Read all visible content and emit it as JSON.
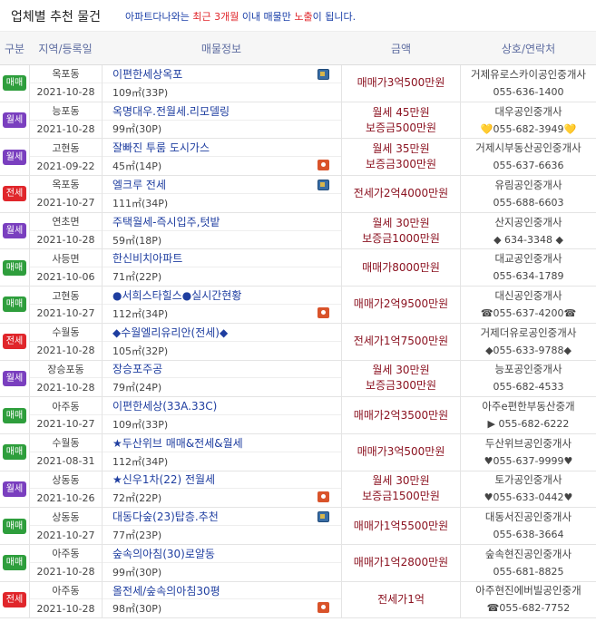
{
  "header": {
    "title": "업체별 추천 물건",
    "notice_prefix": "아파트다나와는 ",
    "notice_red1": "최근 3개월",
    "notice_mid": " 이내 매물만 ",
    "notice_red2": "노출",
    "notice_suffix": "이 됩니다."
  },
  "columns": {
    "type": "구분",
    "region": "지역/등록일",
    "info": "매물정보",
    "price": "금액",
    "agency": "상호/연락처"
  },
  "colors": {
    "매매": "#2e9e3c",
    "월세": "#7a3fbf",
    "전세": "#e0262b"
  },
  "listings": [
    {
      "type": "매매",
      "region": "옥포동",
      "date": "2021-10-28",
      "name": "이편한세상옥포",
      "area": "109㎡(33P)",
      "icons": [
        "map"
      ],
      "price1": "매매가3억500만원",
      "price2": "",
      "agency": "거제유로스카이공인중개사",
      "phone": "055-636-1400"
    },
    {
      "type": "월세",
      "region": "능포동",
      "date": "2021-10-28",
      "name": "옥명대우.전월세.리모델링",
      "area": "99㎡(30P)",
      "icons": [],
      "price1": "월세 45만원",
      "price2": "보증금500만원",
      "agency": "대우공인중개사",
      "phone": "💛055-682-3949💛"
    },
    {
      "type": "월세",
      "region": "고현동",
      "date": "2021-09-22",
      "name": "잘빠진 투룸 도시가스",
      "area": "45㎡(14P)",
      "icons": [
        "cam"
      ],
      "price1": "월세 35만원",
      "price2": "보증금300만원",
      "agency": "거제시부동산공인중개사",
      "phone": "055-637-6636"
    },
    {
      "type": "전세",
      "region": "옥포동",
      "date": "2021-10-27",
      "name": "엘크루 전세",
      "area": "111㎡(34P)",
      "icons": [
        "map"
      ],
      "price1": "전세가2억4000만원",
      "price2": "",
      "agency": "유림공인중개사",
      "phone": "055-688-6603"
    },
    {
      "type": "월세",
      "region": "연초면",
      "date": "2021-10-28",
      "name": "주택월세-즉시입주,텃밭",
      "area": "59㎡(18P)",
      "icons": [],
      "price1": "월세 30만원",
      "price2": "보증금1000만원",
      "agency": "산지공인중개사",
      "phone": "◆ 634-3348 ◆"
    },
    {
      "type": "매매",
      "region": "사등면",
      "date": "2021-10-06",
      "name": "한신비치아파트",
      "area": "71㎡(22P)",
      "icons": [],
      "price1": "매매가8000만원",
      "price2": "",
      "agency": "대교공인중개사",
      "phone": "055-634-1789"
    },
    {
      "type": "매매",
      "region": "고현동",
      "date": "2021-10-27",
      "name": "●서희스타힐스●실시간현황",
      "area": "112㎡(34P)",
      "icons": [
        "cam"
      ],
      "price1": "매매가2억9500만원",
      "price2": "",
      "agency": "대신공인중개사",
      "phone": "☎055-637-4200☎"
    },
    {
      "type": "전세",
      "region": "수월동",
      "date": "2021-10-28",
      "name": "◆수월엘리유리안(전세)◆",
      "area": "105㎡(32P)",
      "icons": [],
      "price1": "전세가1억7500만원",
      "price2": "",
      "agency": "거제더유로공인중개사",
      "phone": "◆055-633-9788◆"
    },
    {
      "type": "월세",
      "region": "장승포동",
      "date": "2021-10-28",
      "name": "장승포주공",
      "area": "79㎡(24P)",
      "icons": [],
      "price1": "월세 30만원",
      "price2": "보증금300만원",
      "agency": "능포공인중개사",
      "phone": "055-682-4533"
    },
    {
      "type": "매매",
      "region": "아주동",
      "date": "2021-10-27",
      "name": "이편한세상(33A.33C)",
      "area": "109㎡(33P)",
      "icons": [],
      "price1": "매매가2억3500만원",
      "price2": "",
      "agency": "아주e편한부동산중개",
      "phone": "▶ 055-682-6222"
    },
    {
      "type": "매매",
      "region": "수월동",
      "date": "2021-08-31",
      "name": "★두산위브 매매&전세&월세",
      "area": "112㎡(34P)",
      "icons": [],
      "price1": "매매가3억500만원",
      "price2": "",
      "agency": "두산위브공인중개사",
      "phone": "♥055-637-9999♥"
    },
    {
      "type": "월세",
      "region": "상동동",
      "date": "2021-10-26",
      "name": "★신우1차(22) 전월세",
      "area": "72㎡(22P)",
      "icons": [
        "cam"
      ],
      "price1": "월세 30만원",
      "price2": "보증금1500만원",
      "agency": "토가공인중개사",
      "phone": "♥055-633-0442♥"
    },
    {
      "type": "매매",
      "region": "상동동",
      "date": "2021-10-27",
      "name": "대동다숲(23)탑층.추천",
      "area": "77㎡(23P)",
      "icons": [
        "map"
      ],
      "price1": "매매가1억5500만원",
      "price2": "",
      "agency": "대동서진공인중개사",
      "phone": "055-638-3664"
    },
    {
      "type": "매매",
      "region": "아주동",
      "date": "2021-10-28",
      "name": "숲속의아침(30)로얄동",
      "area": "99㎡(30P)",
      "icons": [],
      "price1": "매매가1억2800만원",
      "price2": "",
      "agency": "숲속현진공인중개사",
      "phone": "055-681-8825"
    },
    {
      "type": "전세",
      "region": "아주동",
      "date": "2021-10-28",
      "name": "올전세/숲속의아침30평",
      "area": "98㎡(30P)",
      "icons": [
        "cam"
      ],
      "price1": "전세가1억",
      "price2": "",
      "agency": "아주현진에버빌공인중개",
      "phone": "☎055-682-7752"
    }
  ]
}
